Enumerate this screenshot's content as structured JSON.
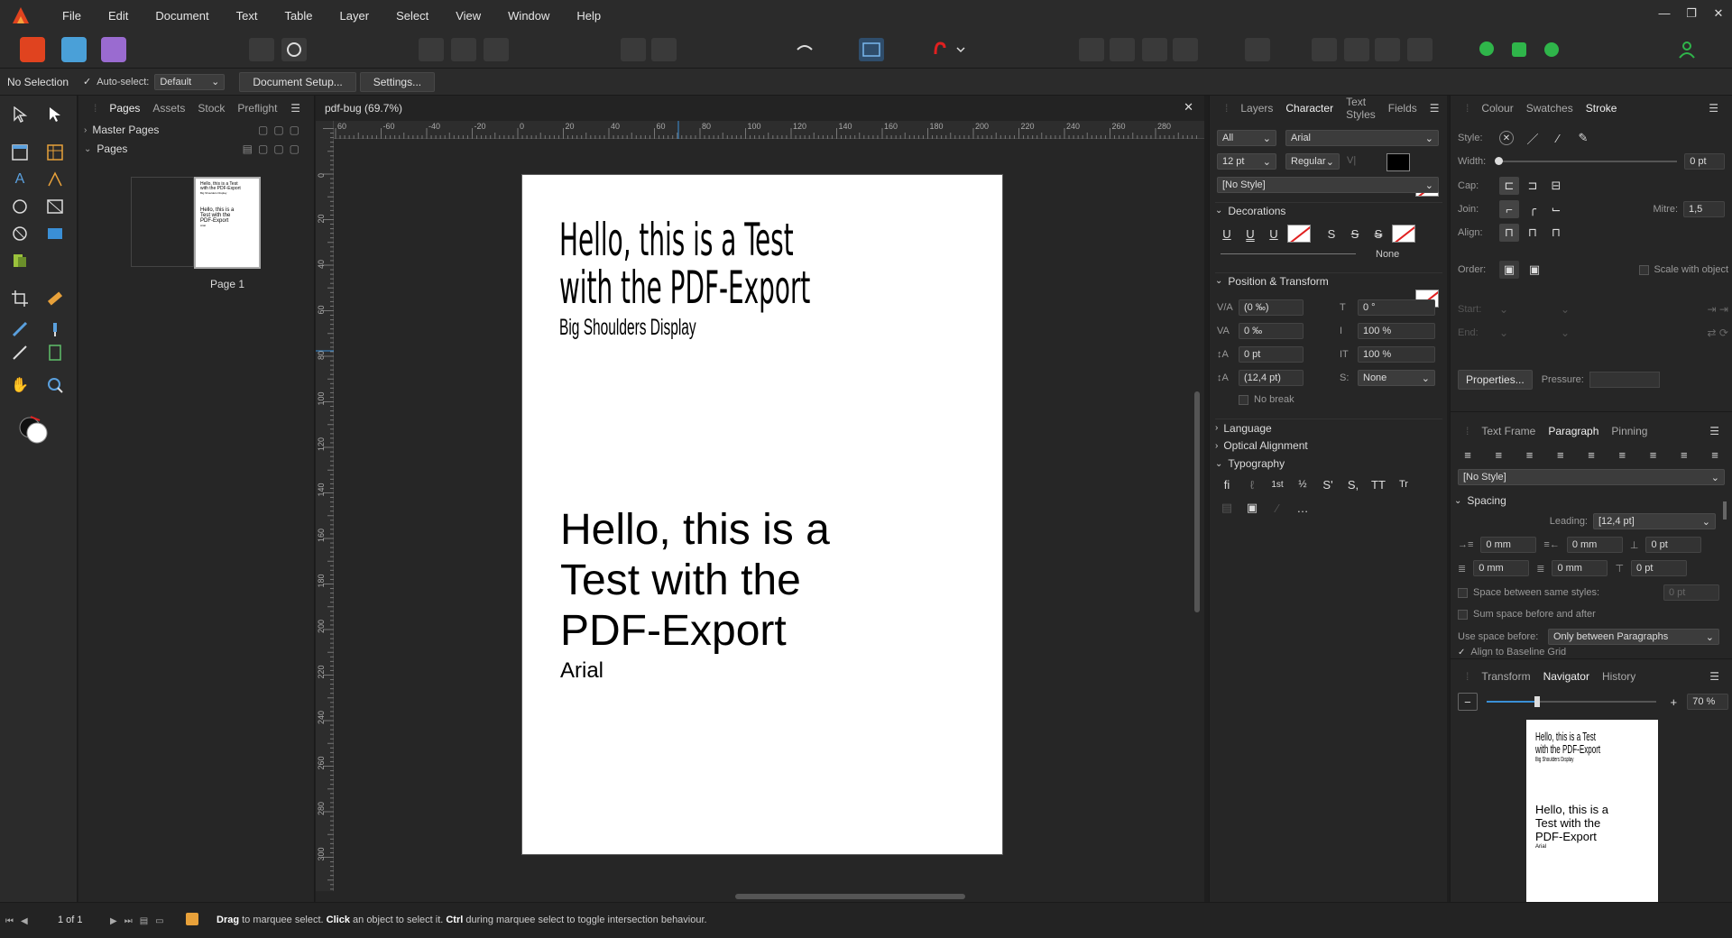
{
  "menubar": {
    "items": [
      "File",
      "Edit",
      "Document",
      "Text",
      "Table",
      "Layer",
      "Select",
      "View",
      "Window",
      "Help"
    ],
    "window_controls": [
      "minimize-icon",
      "restore-icon",
      "close-icon"
    ]
  },
  "context": {
    "selection": "No Selection",
    "autoselect_label": "Auto-select:",
    "autoselect_value": "Default",
    "document_setup": "Document Setup...",
    "settings": "Settings..."
  },
  "pages_panel": {
    "tabs": [
      "Pages",
      "Assets",
      "Stock",
      "Preflight"
    ],
    "master_pages": "Master Pages",
    "pages": "Pages",
    "page_label": "Page 1"
  },
  "document": {
    "tab_title": "pdf-bug (69.7%)",
    "ruler_unit": "mm",
    "ruler_h": [
      "60",
      "-60",
      "-40",
      "-20",
      "0",
      "20",
      "40",
      "60",
      "80",
      "100",
      "120",
      "140",
      "160",
      "180",
      "200",
      "220",
      "240",
      "260",
      "280"
    ],
    "ruler_v": [
      "0",
      "20",
      "40",
      "60",
      "80",
      "100",
      "120",
      "140",
      "160",
      "180",
      "200",
      "220",
      "240",
      "260",
      "280",
      "300"
    ],
    "text1_line1": "Hello, this is a Test",
    "text1_line2": "with the PDF-Export",
    "text1_font": "Big Shoulders Display",
    "text2_line1": "Hello, this is a",
    "text2_line2": "Test with the",
    "text2_line3": "PDF-Export",
    "text2_font": "Arial"
  },
  "character_panel": {
    "tabs": [
      "Layers",
      "Character",
      "Text Styles",
      "Fields"
    ],
    "scope": "All",
    "font": "Arial",
    "size": "12 pt",
    "weight": "Regular",
    "style": "[No Style]",
    "decorations": "Decorations",
    "none_label": "None",
    "position_transform": "Position & Transform",
    "kern": "(0 ‰)",
    "track": "0 ‰",
    "baseline": "0 pt",
    "leading": "(12,4 pt)",
    "shear": "0 °",
    "vscale": "100 %",
    "hscale": "100 %",
    "sub_value": "None",
    "no_break": "No break",
    "language": "Language",
    "optical": "Optical Alignment",
    "typography": "Typography",
    "typo_buttons": [
      "fi",
      "ℓ",
      "1st",
      "½",
      "S'",
      "S,",
      "TT",
      "Tr"
    ]
  },
  "stroke_panel": {
    "tabs": [
      "Colour",
      "Swatches",
      "Stroke"
    ],
    "style": "Style:",
    "width": "Width:",
    "width_value": "0 pt",
    "cap": "Cap:",
    "join": "Join:",
    "mitre": "Mitre:",
    "mitre_value": "1,5",
    "align": "Align:",
    "order": "Order:",
    "scale_with_object": "Scale with object",
    "start": "Start:",
    "end": "End:",
    "properties": "Properties...",
    "pressure": "Pressure:"
  },
  "paragraph_panel": {
    "tabs": [
      "Text Frame",
      "Paragraph",
      "Pinning"
    ],
    "style": "[No Style]",
    "spacing": "Spacing",
    "leading_label": "Leading:",
    "leading_value": "[12,4 pt]",
    "left_indent": "0 mm",
    "right_indent": "0 mm",
    "space_before": "0 pt",
    "first_line": "0 mm",
    "last_line": "0 mm",
    "space_after": "0 pt",
    "space_between": "Space between same styles:",
    "space_between_value": "0 pt",
    "sum_space": "Sum space before and after",
    "use_space_label": "Use space before:",
    "use_space_value": "Only between Paragraphs",
    "align_baseline": "Align to Baseline Grid"
  },
  "navigator_panel": {
    "tabs": [
      "Transform",
      "Navigator",
      "History"
    ],
    "zoom": "70 %",
    "zoom_fraction": 0.3
  },
  "status": {
    "page_count": "1 of 1",
    "hint_b1": "Drag",
    "hint_t1": " to marquee select. ",
    "hint_b2": "Click",
    "hint_t2": " an object to select it. ",
    "hint_b3": "Ctrl",
    "hint_t3": " during marquee select to toggle intersection behaviour."
  },
  "colors": {
    "app_bg": "#1e1e1e",
    "panel_bg": "#262626",
    "accent_red": "#e02020",
    "accent_blue": "#3a8fd6",
    "persona_publisher": "#e0431f",
    "persona_designer": "#4aa0d8",
    "persona_photo": "#9a6bd0"
  }
}
